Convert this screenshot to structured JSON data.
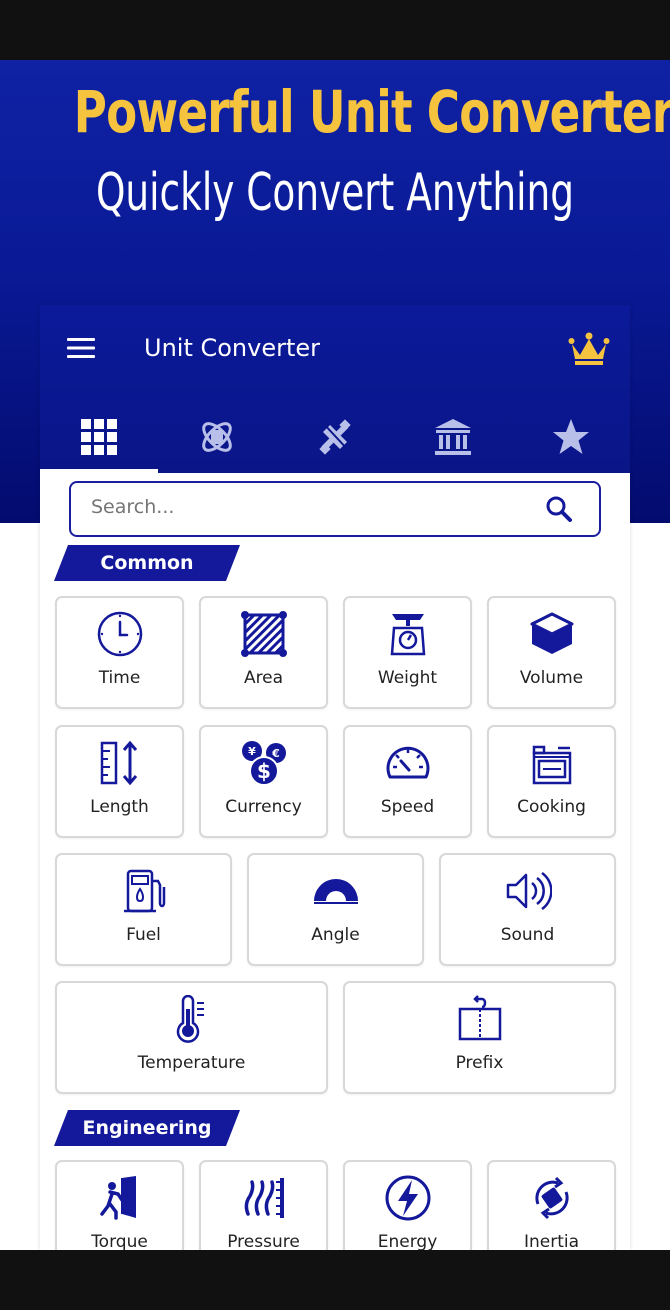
{
  "promo": {
    "headline": "Powerful Unit Converter",
    "subheadline": "Quickly Convert Anything"
  },
  "app": {
    "title": "Unit Converter",
    "accent_color": "#13199a",
    "crown_color": "#f6c33f",
    "tabs": [
      {
        "icon": "grid-icon",
        "active": true
      },
      {
        "icon": "atom-icon",
        "active": false
      },
      {
        "icon": "satellite-icon",
        "active": false
      },
      {
        "icon": "bank-icon",
        "active": false
      },
      {
        "icon": "star-icon",
        "active": false
      }
    ]
  },
  "search": {
    "placeholder": "Search..."
  },
  "sections": {
    "common": {
      "title": "Common",
      "items": [
        {
          "label": "Time",
          "icon": "clock-icon"
        },
        {
          "label": "Area",
          "icon": "area-icon"
        },
        {
          "label": "Weight",
          "icon": "scale-icon"
        },
        {
          "label": "Volume",
          "icon": "cube-icon"
        },
        {
          "label": "Length",
          "icon": "ruler-icon"
        },
        {
          "label": "Currency",
          "icon": "currency-icon"
        },
        {
          "label": "Speed",
          "icon": "speedometer-icon"
        },
        {
          "label": "Cooking",
          "icon": "stove-icon"
        },
        {
          "label": "Fuel",
          "icon": "fuel-pump-icon"
        },
        {
          "label": "Angle",
          "icon": "protractor-icon"
        },
        {
          "label": "Sound",
          "icon": "speaker-icon"
        },
        {
          "label": "Temperature",
          "icon": "thermometer-icon"
        },
        {
          "label": "Prefix",
          "icon": "book-icon"
        }
      ]
    },
    "engineering": {
      "title": "Engineering",
      "items": [
        {
          "label": "Torque",
          "icon": "door-push-icon"
        },
        {
          "label": "Pressure",
          "icon": "pressure-icon"
        },
        {
          "label": "Energy",
          "icon": "lightning-icon"
        },
        {
          "label": "Inertia",
          "icon": "rotation-icon"
        }
      ]
    }
  }
}
